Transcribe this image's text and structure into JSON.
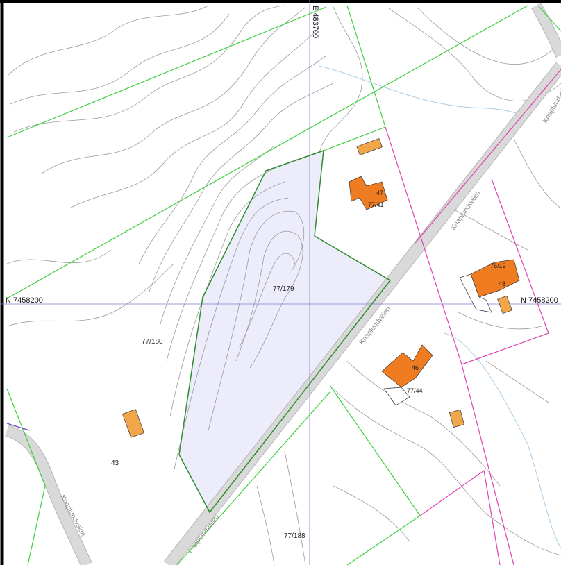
{
  "map": {
    "grid": {
      "easting_label": "E 483700",
      "northing_left_label": "N 7458200",
      "northing_right_label": "N 7458200"
    },
    "parcels": {
      "highlighted": "77/179",
      "west": "77/180",
      "south": "77/188",
      "house_north": "77/41",
      "house_south": "77/44",
      "house_east": "76/19"
    },
    "house_numbers": {
      "north": "47",
      "east": "48",
      "south": "46",
      "southwest": "43"
    },
    "road_name": "Knaplundveien",
    "colors": {
      "highlight_fill": "#ececfb",
      "highlight_border": "#2e8b2e",
      "parcel_line": "#3ccf3c",
      "municipal_line": "#e040b0",
      "purple_line": "#7040c0",
      "grid_line": "#7b7bd6",
      "contour": "#9a9a9a",
      "stream": "#a8cce6",
      "road_fill": "#d9d9d9",
      "road_edge": "#b5b5b5",
      "house_main": "#f07c22",
      "house_minor": "#f2a64a"
    }
  }
}
